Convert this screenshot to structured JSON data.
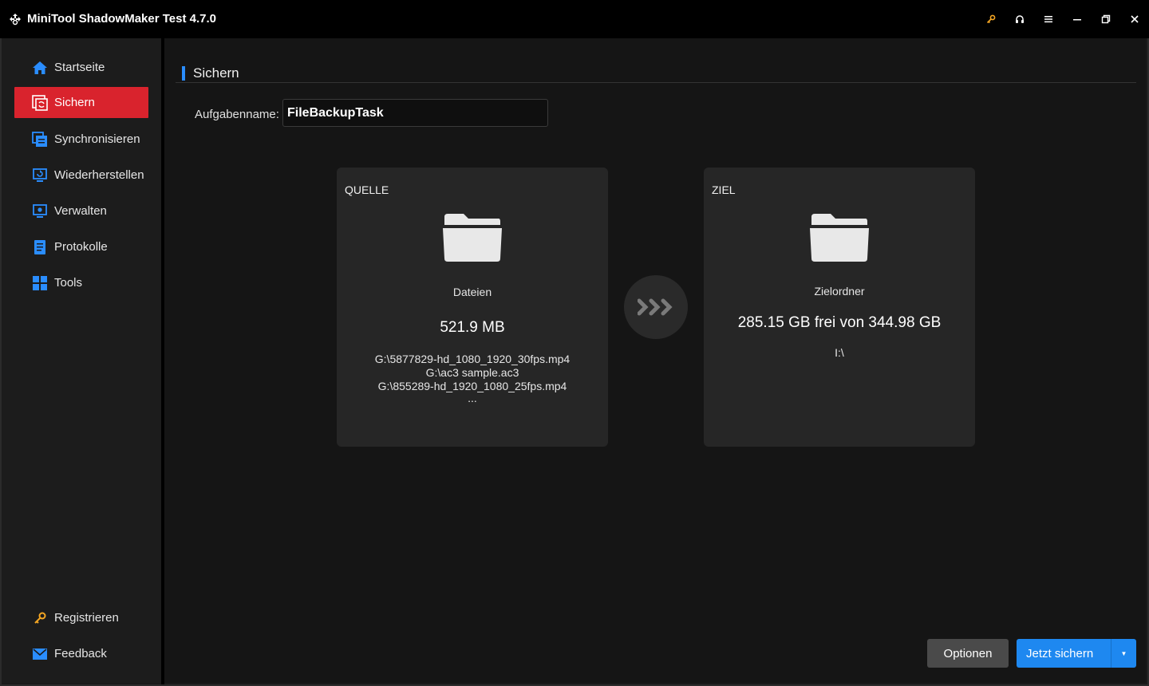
{
  "window": {
    "title": "MiniTool ShadowMaker Test 4.7.0",
    "controls": [
      "key-icon",
      "headset-icon",
      "menu-icon",
      "minimize-icon",
      "restore-icon",
      "close-icon"
    ]
  },
  "sidebar": {
    "items": [
      {
        "label": "Startseite",
        "icon": "home-icon"
      },
      {
        "label": "Sichern",
        "icon": "backup-icon",
        "active": true
      },
      {
        "label": "Synchronisieren",
        "icon": "sync-icon"
      },
      {
        "label": "Wiederherstellen",
        "icon": "restore-icon"
      },
      {
        "label": "Verwalten",
        "icon": "manage-icon"
      },
      {
        "label": "Protokolle",
        "icon": "logs-icon"
      },
      {
        "label": "Tools",
        "icon": "tools-icon"
      }
    ],
    "bottom": [
      {
        "label": "Registrieren",
        "icon": "key-icon"
      },
      {
        "label": "Feedback",
        "icon": "mail-icon"
      }
    ]
  },
  "main": {
    "section_title": "Sichern",
    "task_name_label": "Aufgabenname:",
    "task_name_value": "FileBackupTask",
    "source": {
      "label": "QUELLE",
      "type": "Dateien",
      "size": "521.9 MB",
      "paths": [
        "G:\\5877829-hd_1080_1920_30fps.mp4",
        "G:\\ac3 sample.ac3",
        "G:\\855289-hd_1920_1080_25fps.mp4",
        "..."
      ]
    },
    "destination": {
      "label": "ZIEL",
      "type": "Zielordner",
      "space": "285.15 GB frei von 344.98 GB",
      "path": "I:\\"
    },
    "buttons": {
      "options": "Optionen",
      "backup_now": "Jetzt sichern"
    }
  },
  "colors": {
    "accent_blue": "#1e88f0",
    "active_red": "#d9232d",
    "nav_icon_blue": "#2a8dff",
    "key_orange": "#f5a623"
  }
}
